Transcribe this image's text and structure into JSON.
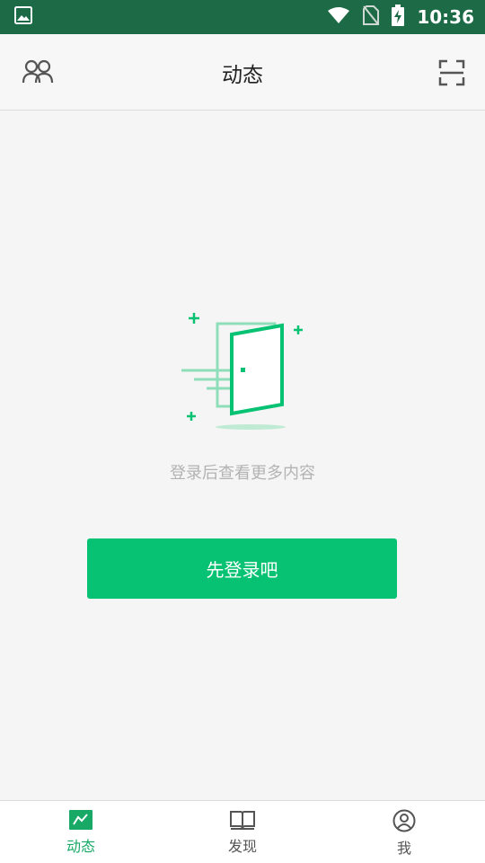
{
  "status_bar": {
    "time": "10:36"
  },
  "header": {
    "title": "动态"
  },
  "empty_state": {
    "hint": "登录后查看更多内容",
    "login_button_label": "先登录吧"
  },
  "bottom_nav": {
    "items": [
      {
        "label": "动态",
        "icon": "activity-icon",
        "active": true
      },
      {
        "label": "发现",
        "icon": "book-icon",
        "active": false
      },
      {
        "label": "我",
        "icon": "profile-icon",
        "active": false
      }
    ]
  },
  "colors": {
    "status_bar": "#1d6b46",
    "accent": "#07c273",
    "active_nav": "#18a967",
    "hint_text": "#b3b3b3"
  }
}
